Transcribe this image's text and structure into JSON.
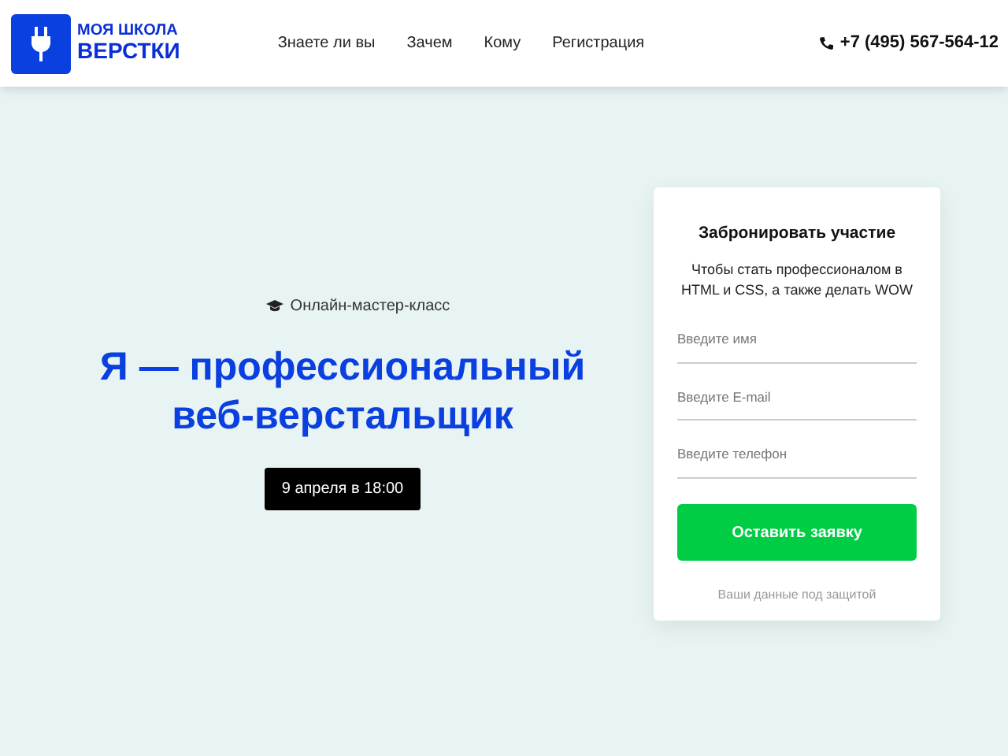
{
  "logo": {
    "line_1": "МОЯ ШКОЛА",
    "line_2": "ВЕРСТКИ"
  },
  "nav": [
    {
      "label": "Знаете ли вы"
    },
    {
      "label": "Зачем"
    },
    {
      "label": "Кому"
    },
    {
      "label": "Регистрация"
    }
  ],
  "phone": "+7 (495) 567-564-12",
  "hero": {
    "tag": "Онлайн-мастер-класс",
    "title_line_1": "Я — профессиональный",
    "title_line_2": "веб-верстальщик",
    "date": "9 апреля в 18:00"
  },
  "form": {
    "title": "Забронировать участие",
    "subtitle": "Чтобы стать профессионалом в HTML и CSS, а также делать WOW",
    "fields": [
      {
        "placeholder": "Введите имя"
      },
      {
        "placeholder": "Введите E-mail"
      },
      {
        "placeholder": "Введите телефон"
      }
    ],
    "button": "Оставить заявку",
    "note": "Ваши данные под защитой"
  }
}
